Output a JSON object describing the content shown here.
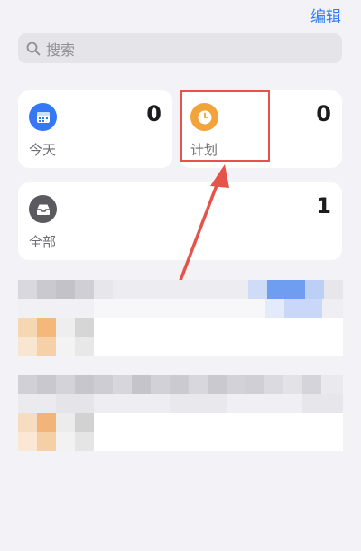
{
  "header": {
    "edit_label": "编辑"
  },
  "search": {
    "placeholder": "搜索"
  },
  "cards": {
    "today": {
      "label": "今天",
      "count": "0",
      "icon": "calendar-icon",
      "color": "#3478f6"
    },
    "plan": {
      "label": "计划",
      "count": "0",
      "icon": "clock-icon",
      "color": "#f2a33a"
    },
    "all": {
      "label": "全部",
      "count": "1",
      "icon": "tray-icon",
      "color": "#5a5a5f"
    }
  },
  "annotation": {
    "color": "#e5534b"
  }
}
